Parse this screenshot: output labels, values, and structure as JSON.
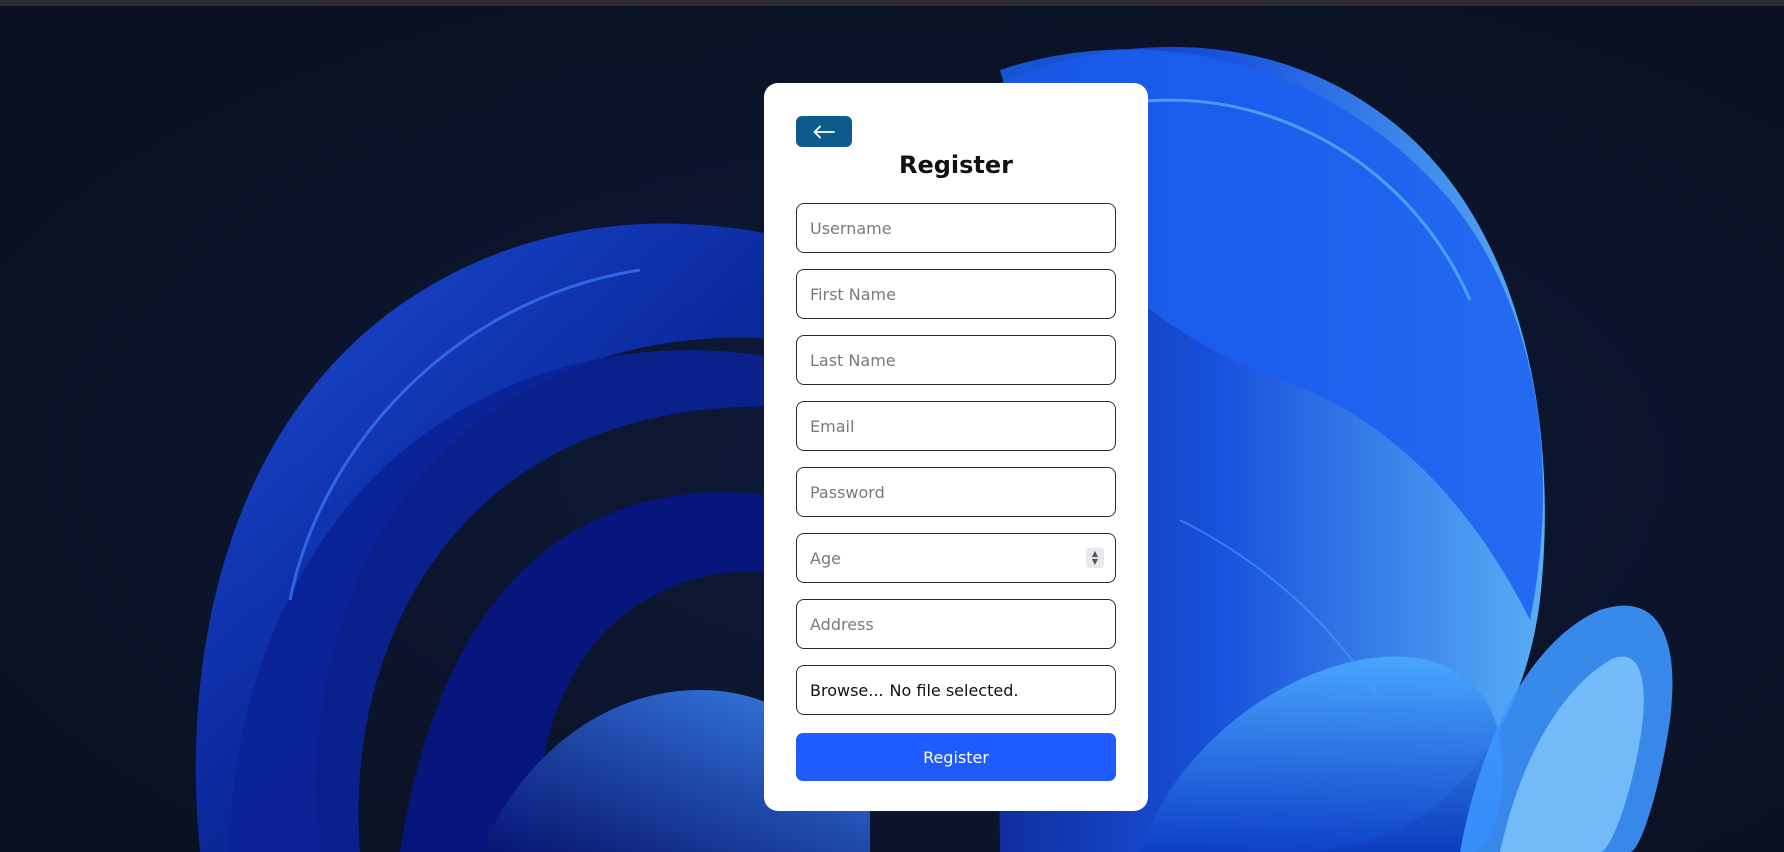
{
  "page": {
    "title": "Register"
  },
  "back_button": {
    "icon": "arrow-left-icon"
  },
  "form": {
    "username": {
      "placeholder": "Username",
      "value": ""
    },
    "first_name": {
      "placeholder": "First Name",
      "value": ""
    },
    "last_name": {
      "placeholder": "Last Name",
      "value": ""
    },
    "email": {
      "placeholder": "Email",
      "value": ""
    },
    "password": {
      "placeholder": "Password",
      "value": ""
    },
    "age": {
      "placeholder": "Age",
      "value": ""
    },
    "address": {
      "placeholder": "Address",
      "value": ""
    },
    "file": {
      "browse_label": "Browse...",
      "status": "No file selected."
    },
    "submit_label": "Register"
  },
  "colors": {
    "back_button": "#0b5b8c",
    "submit_button": "#1f5cff",
    "card": "#ffffff",
    "background": "#0b1220"
  }
}
